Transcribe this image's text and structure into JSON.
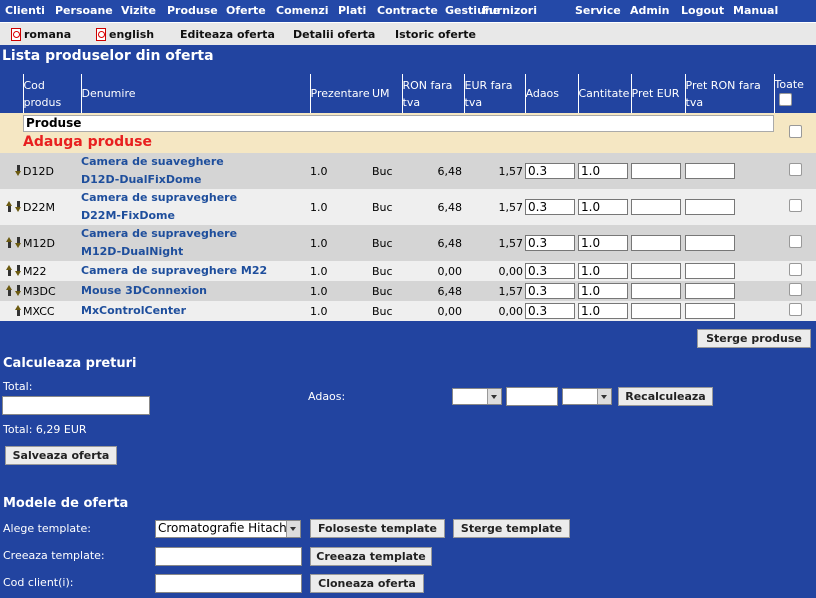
{
  "topnav": [
    "Clienti",
    "Persoane",
    "Vizite",
    "Produse",
    "Oferte",
    "Comenzi",
    "Plati",
    "Contracte",
    "Gestiune",
    "Furnizori",
    "Service",
    "Admin",
    "Logout",
    "Manual"
  ],
  "subnav": {
    "romana": "romana",
    "english": "english",
    "edit": "Editeaza oferta",
    "details": "Detalii oferta",
    "history": "Istoric oferte"
  },
  "page_title": "Lista produselor din oferta",
  "table": {
    "headers": {
      "cod": "Cod produs",
      "denumire": "Denumire",
      "prezentare": "Prezentare",
      "um": "UM",
      "ron": "RON fara tva",
      "eur": "EUR fara tva",
      "adaos": "Adaos",
      "cantitate": "Cantitate",
      "pret_eur": "Pret EUR",
      "pret_ron": "Pret RON fara tva",
      "toate": "Toate"
    },
    "section_label": "Produse",
    "add_link": "Adauga produse",
    "rows": [
      {
        "code": "D12D",
        "name1": "Camera de suaveghere",
        "name2": "D12D-DualFixDome",
        "prez": "1.0",
        "um": "Buc",
        "ron": "6,48",
        "eur": "1,57",
        "adaos": "0.3",
        "cant": "1.0",
        "up": false,
        "down": true
      },
      {
        "code": "D22M",
        "name1": "Camera de supraveghere",
        "name2": "D22M-FixDome",
        "prez": "1.0",
        "um": "Buc",
        "ron": "6,48",
        "eur": "1,57",
        "adaos": "0.3",
        "cant": "1.0",
        "up": true,
        "down": true
      },
      {
        "code": "M12D",
        "name1": "Camera de supraveghere",
        "name2": "M12D-DualNight",
        "prez": "1.0",
        "um": "Buc",
        "ron": "6,48",
        "eur": "1,57",
        "adaos": "0.3",
        "cant": "1.0",
        "up": true,
        "down": true
      },
      {
        "code": "M22",
        "name1": "Camera de supraveghere M22",
        "name2": "",
        "prez": "1.0",
        "um": "Buc",
        "ron": "0,00",
        "eur": "0,00",
        "adaos": "0.3",
        "cant": "1.0",
        "up": true,
        "down": true
      },
      {
        "code": "M3DC",
        "name1": "Mouse 3DConnexion",
        "name2": "",
        "prez": "1.0",
        "um": "Buc",
        "ron": "6,48",
        "eur": "1,57",
        "adaos": "0.3",
        "cant": "1.0",
        "up": true,
        "down": true
      },
      {
        "code": "MXCC",
        "name1": "MxControlCenter",
        "name2": "",
        "prez": "1.0",
        "um": "Buc",
        "ron": "0,00",
        "eur": "0,00",
        "adaos": "0.3",
        "cant": "1.0",
        "up": true,
        "down": false
      }
    ]
  },
  "delete_products": "Sterge produse",
  "calc": {
    "title": "Calculeaza preturi",
    "total_label": "Total:",
    "adaos_label": "Adaos:",
    "recalc": "Recalculeaza",
    "total_text": "Total: 6,29 EUR",
    "save": "Salveaza oferta"
  },
  "templates": {
    "title": "Modele de oferta",
    "choose_label": "Alege template:",
    "selected": "Cromatografie Hitachi",
    "use": "Foloseste template",
    "delete": "Sterge template",
    "create_label": "Creeaza template:",
    "create": "Creeaza template",
    "client_label": "Cod client(i):",
    "clone": "Cloneaza oferta"
  }
}
